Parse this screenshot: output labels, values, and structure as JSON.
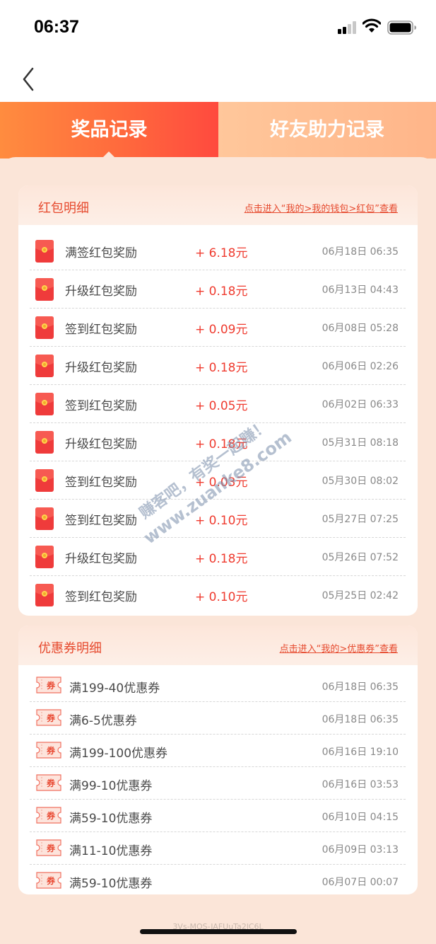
{
  "status": {
    "time": "06:37"
  },
  "tabs": [
    {
      "label": "奖品记录",
      "active": true
    },
    {
      "label": "好友助力记录",
      "active": false
    }
  ],
  "red_packets": {
    "title": "红包明细",
    "link": "点击进入“我的>我的钱包>红包”查看",
    "rows": [
      {
        "name": "满签红包奖励",
        "amount": "+ 6.18元",
        "time": "06月18日 06:35"
      },
      {
        "name": "升级红包奖励",
        "amount": "+ 0.18元",
        "time": "06月13日 04:43"
      },
      {
        "name": "签到红包奖励",
        "amount": "+ 0.09元",
        "time": "06月08日 05:28"
      },
      {
        "name": "升级红包奖励",
        "amount": "+ 0.18元",
        "time": "06月06日 02:26"
      },
      {
        "name": "签到红包奖励",
        "amount": "+ 0.05元",
        "time": "06月02日 06:33"
      },
      {
        "name": "升级红包奖励",
        "amount": "+ 0.18元",
        "time": "05月31日 08:18"
      },
      {
        "name": "签到红包奖励",
        "amount": "+ 0.03元",
        "time": "05月30日 08:02"
      },
      {
        "name": "签到红包奖励",
        "amount": "+ 0.10元",
        "time": "05月27日 07:25"
      },
      {
        "name": "升级红包奖励",
        "amount": "+ 0.18元",
        "time": "05月26日 07:52"
      },
      {
        "name": "签到红包奖励",
        "amount": "+ 0.10元",
        "time": "05月25日 02:42"
      }
    ]
  },
  "coupons": {
    "title": "优惠券明细",
    "link": "点击进入“我的>优惠券”查看",
    "icon_label": "券",
    "rows": [
      {
        "name": "满199-40优惠券",
        "time": "06月18日 06:35"
      },
      {
        "name": "满6-5优惠券",
        "time": "06月18日 06:35"
      },
      {
        "name": "满199-100优惠券",
        "time": "06月16日 19:10"
      },
      {
        "name": "满99-10优惠券",
        "time": "06月16日 03:53"
      },
      {
        "name": "满59-10优惠券",
        "time": "06月10日 04:15"
      },
      {
        "name": "满11-10优惠券",
        "time": "06月09日 03:13"
      },
      {
        "name": "满59-10优惠券",
        "time": "06月07日 00:07"
      }
    ]
  },
  "watermark": {
    "line1": "赚客吧，有奖一起赚！",
    "line2": "www.zuanke8.com"
  },
  "footer": "3Vs-MOS-JAFUuTa2lC6L",
  "colors": {
    "accent": "#ef3b2f",
    "tab_active": "#ff5a3e",
    "tab_inactive": "#ffbf93",
    "background": "#fbe5d8"
  }
}
